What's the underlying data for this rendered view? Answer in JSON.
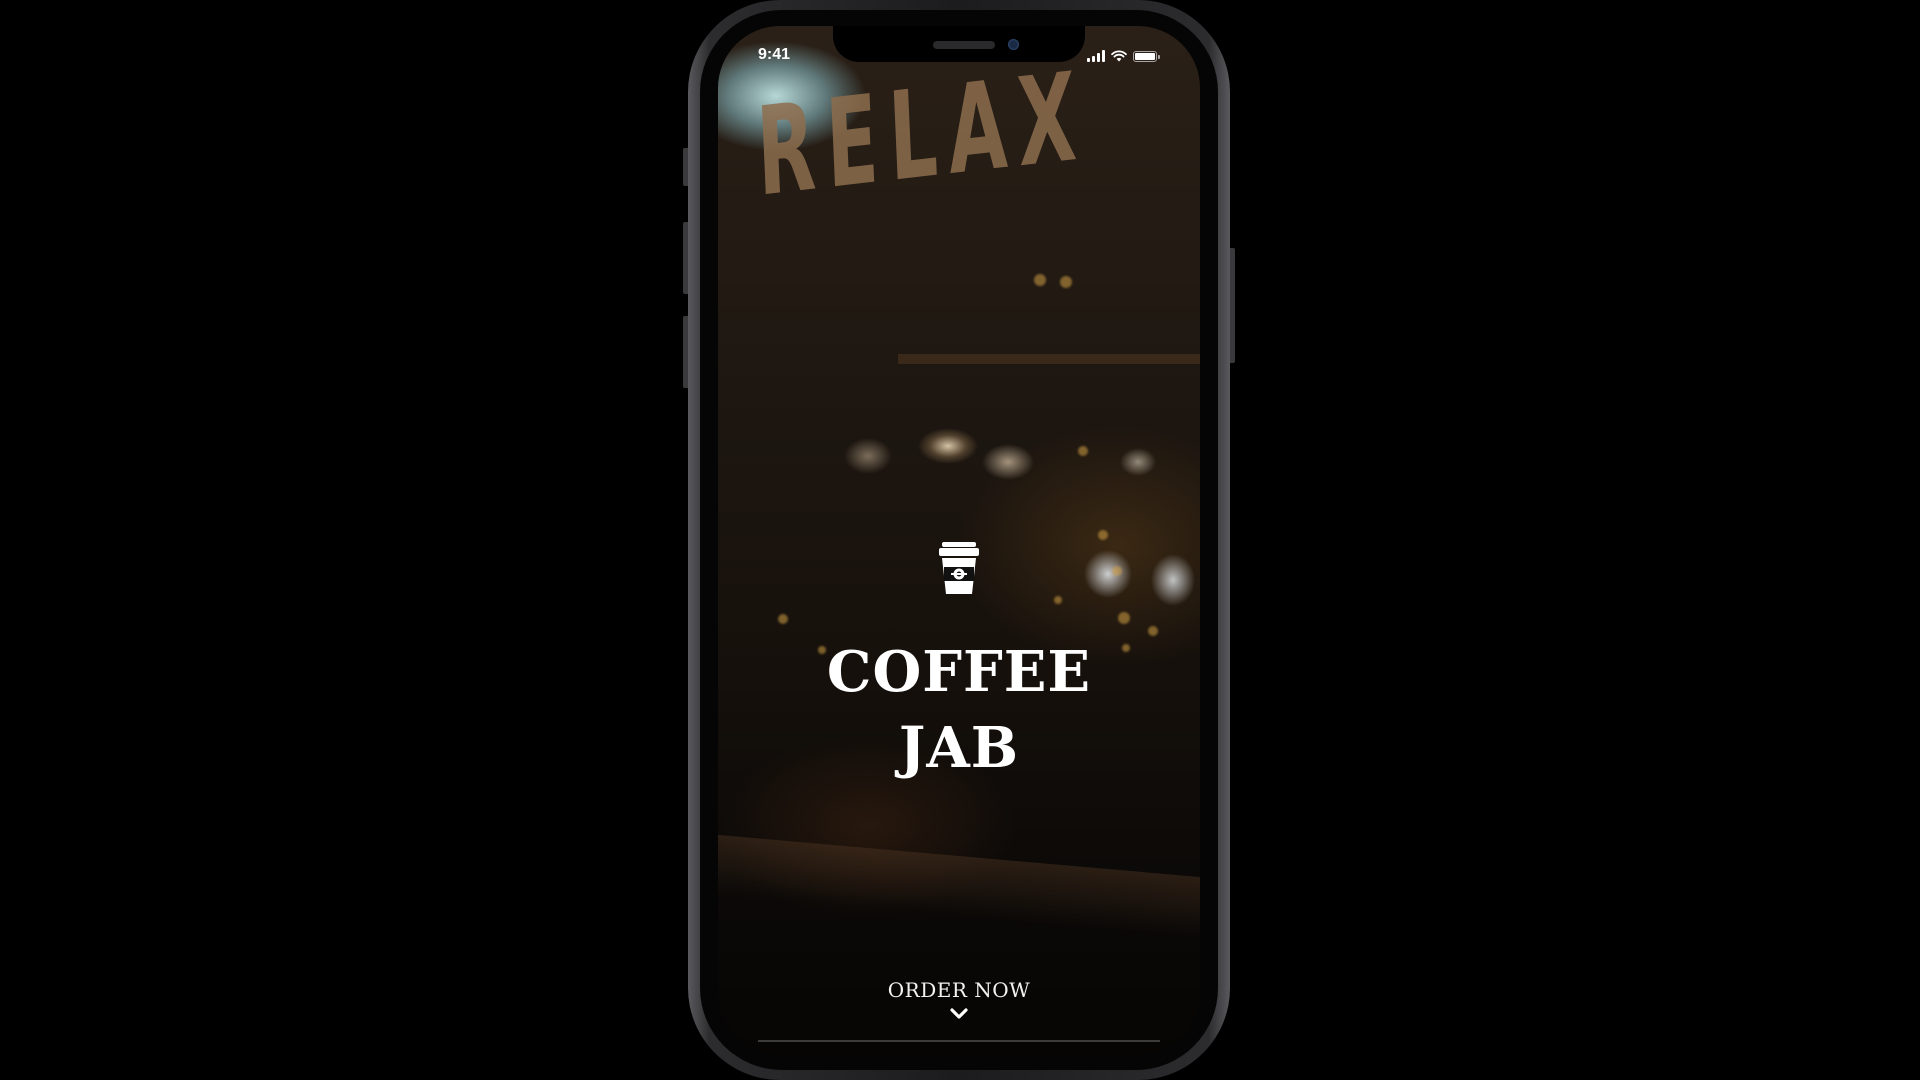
{
  "status_bar": {
    "time": "9:41",
    "icons": [
      "cellular-signal-icon",
      "wifi-icon",
      "battery-icon"
    ]
  },
  "background": {
    "sign_text": "RELAX"
  },
  "brand": {
    "icon": "coffee-cup-icon",
    "title_line1": "COFFEE",
    "title_line2": "JAB"
  },
  "cta": {
    "label": "ORDER NOW",
    "icon": "chevron-down-icon"
  },
  "colors": {
    "background": "#000000",
    "text": "#ffffff",
    "sign": "#8d6e4e"
  }
}
